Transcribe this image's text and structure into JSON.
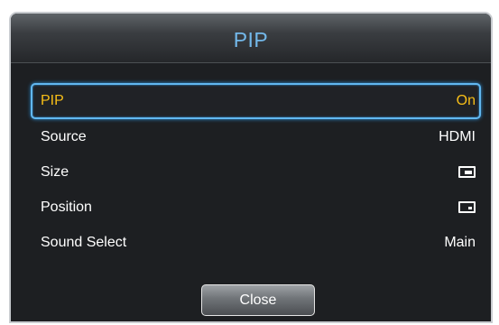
{
  "dialog": {
    "title": "PIP"
  },
  "menu": {
    "items": [
      {
        "label": "PIP",
        "value": "On",
        "selected": true
      },
      {
        "label": "Source",
        "value": "HDMI"
      },
      {
        "label": "Size",
        "icon": "pip-size-icon"
      },
      {
        "label": "Position",
        "icon": "pip-position-icon"
      },
      {
        "label": "Sound Select",
        "value": "Main"
      }
    ]
  },
  "buttons": {
    "close_label": "Close"
  },
  "colors": {
    "title": "#73b8ea",
    "selected_text": "#f7be17",
    "focus_border": "#61b7f0",
    "background": "#1d1f22"
  }
}
